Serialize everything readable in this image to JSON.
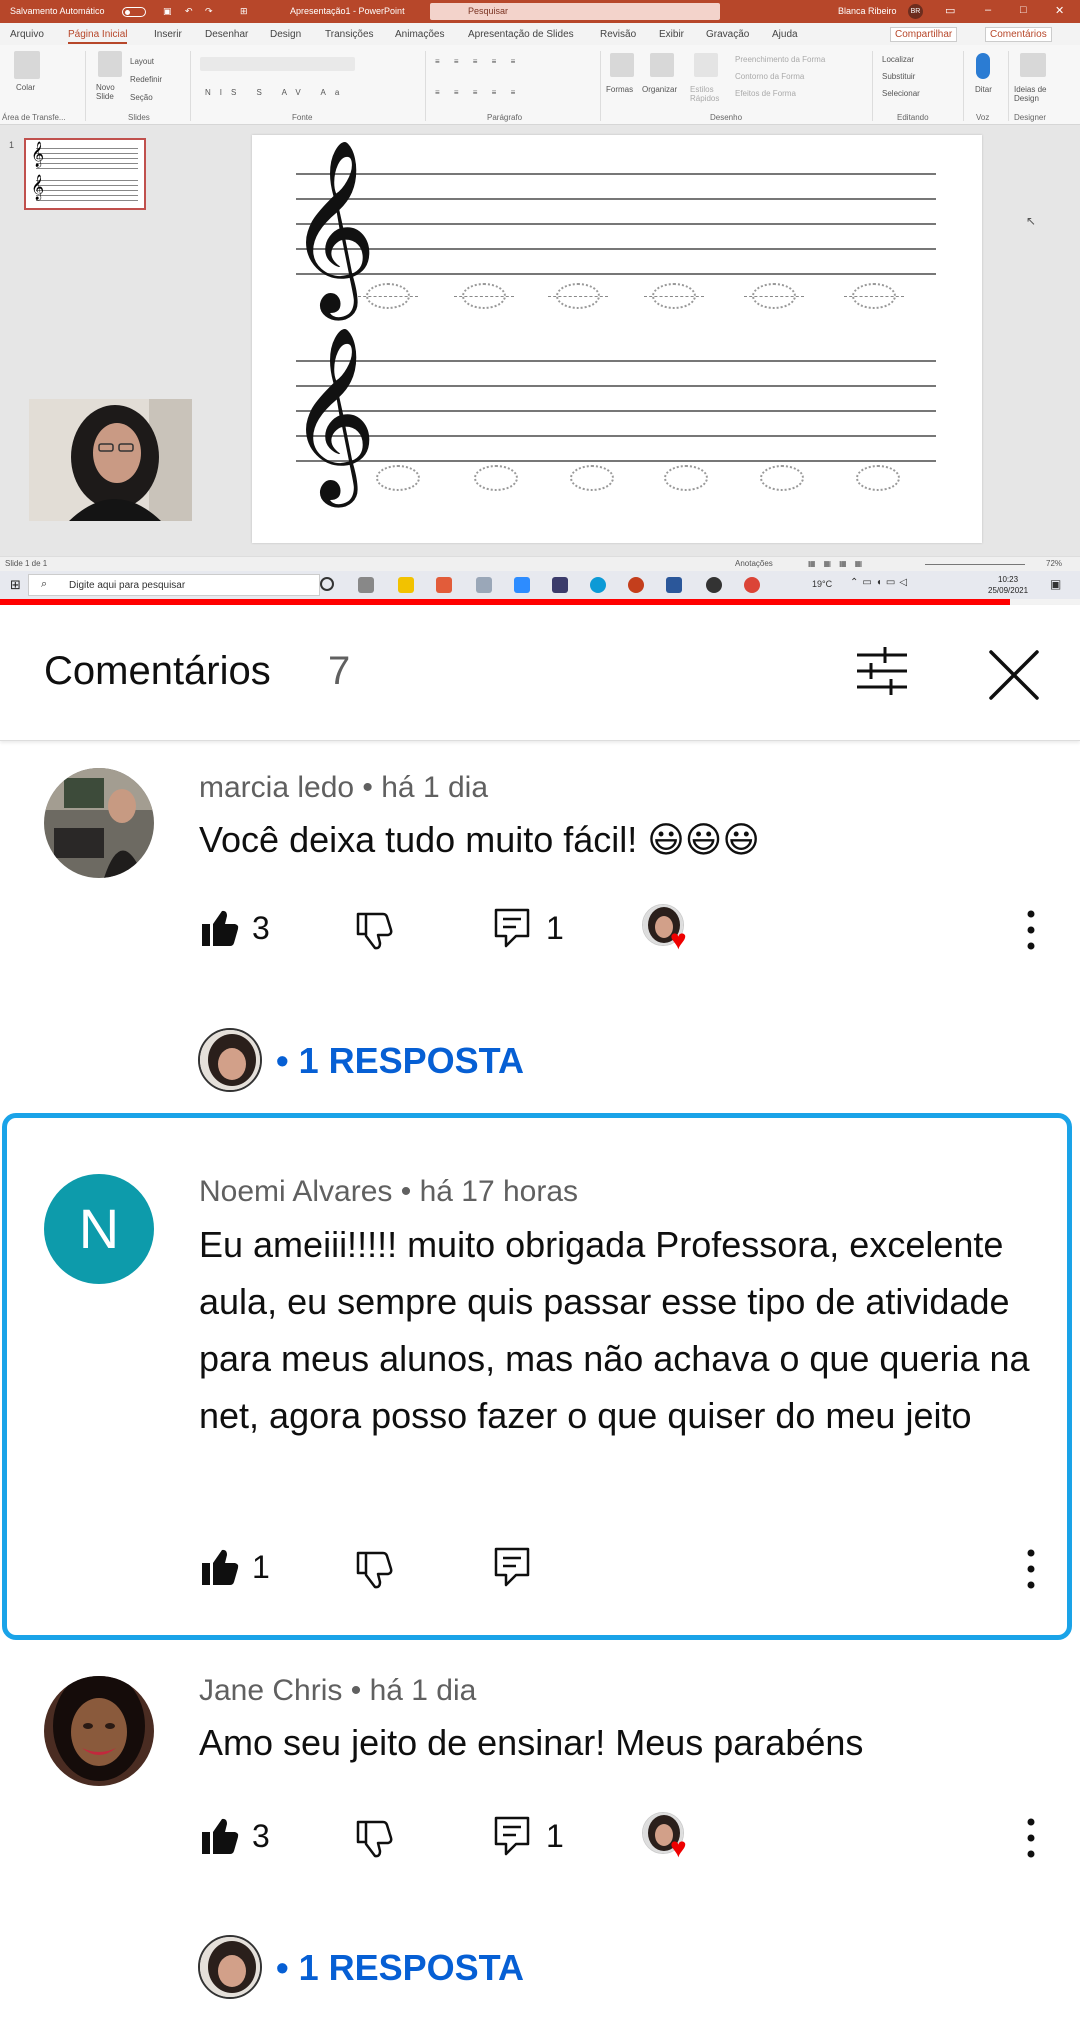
{
  "video": {
    "powerpoint": {
      "autosave_label": "Salvamento Automático",
      "doc_title": "Apresentação1 - PowerPoint",
      "search_placeholder": "Pesquisar",
      "user_name": "Blanca Ribeiro",
      "user_initials": "BR",
      "tabs": [
        "Arquivo",
        "Página Inicial",
        "Inserir",
        "Desenhar",
        "Design",
        "Transições",
        "Animações",
        "Apresentação de Slides",
        "Revisão",
        "Exibir",
        "Gravação",
        "Ajuda"
      ],
      "share_label": "Compartilhar",
      "comments_label": "Comentários",
      "ribbon": {
        "paste_label": "Colar",
        "new_slide_label": "Novo Slide",
        "layout_label": "Layout",
        "reset_label": "Redefinir",
        "section_label": "Seção",
        "shapes_label": "Formas",
        "arrange_label": "Organizar",
        "quick_styles_label": "Estilos Rápidos",
        "shape_fill_label": "Preenchimento da Forma",
        "shape_outline_label": "Contorno da Forma",
        "shape_effects_label": "Efeitos de Forma",
        "find_label": "Localizar",
        "replace_label": "Substituir",
        "select_label": "Selecionar",
        "dictate_label": "Ditar",
        "design_ideas_label": "Ideias de Design",
        "groups": [
          "Área de Transfe...",
          "Slides",
          "Fonte",
          "Parágrafo",
          "Desenho",
          "Editando",
          "Voz",
          "Designer"
        ]
      },
      "thumbnail_number": "1",
      "status_slide": "Slide 1 de 1",
      "status_notes": "Anotações",
      "status_zoom": "72%"
    },
    "taskbar": {
      "search_placeholder": "Digite aqui para pesquisar",
      "weather": "19°C",
      "time": "10:23",
      "date": "25/09/2021"
    },
    "playback_progress": 0.935,
    "colors": {
      "powerpoint_accent": "#b7472a",
      "progress": "#ff0000"
    }
  },
  "comments_panel": {
    "title": "Comentários",
    "count": "7",
    "filter_icon": "sliders-icon",
    "close_icon": "close-icon",
    "comments": [
      {
        "author": "marcia ledo",
        "time": "há 1 dia",
        "meta": "marcia ledo • há 1 dia",
        "text": "Você deixa tudo muito fácil! 😃😃😃",
        "likes": "3",
        "replies_count": "1",
        "creator_heart": true,
        "replies_link": "• 1 RESPOSTA"
      },
      {
        "author": "Noemi Alvares",
        "time": "há 17 horas",
        "meta": "Noemi Alvares • há 17 horas",
        "avatar_letter": "N",
        "text": "Eu ameiii!!!!! muito obrigada Professora, excelente aula, eu sempre quis passar esse tipo de atividade para meus alunos, mas não achava o que queria na net, agora posso fazer o que quiser do meu jeito",
        "likes": "1",
        "highlighted": true
      },
      {
        "author": "Jane Chris",
        "time": "há 1 dia",
        "meta": "Jane Chris • há 1 dia",
        "text": "Amo seu jeito de ensinar! Meus parabéns",
        "likes": "3",
        "replies_count": "1",
        "creator_heart": true,
        "replies_link": "• 1 RESPOSTA"
      }
    ],
    "colors": {
      "link": "#065fd4",
      "highlight_border": "#1aa3e8",
      "avatar_letter_bg": "#0d9bab"
    }
  }
}
